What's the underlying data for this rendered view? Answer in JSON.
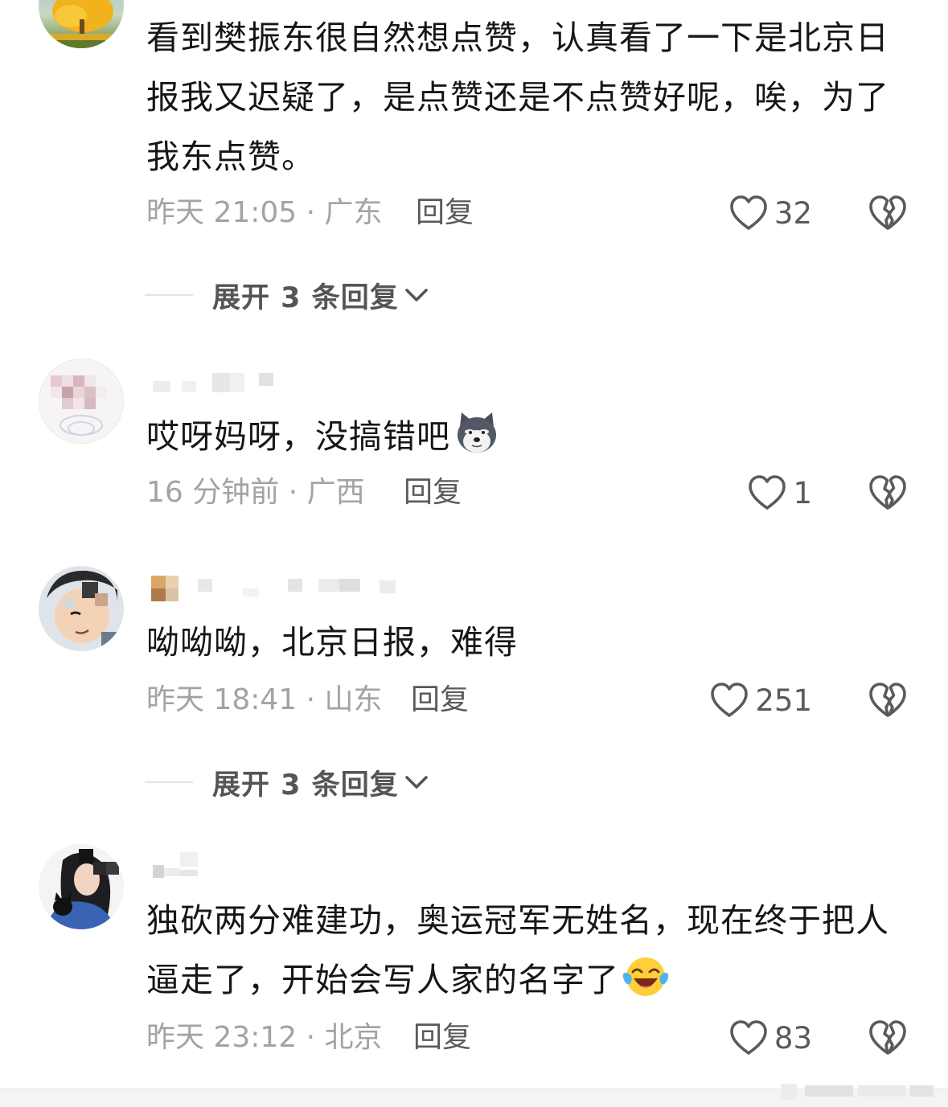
{
  "colors": {
    "text": "#161616",
    "meta": "#a3a3a3",
    "action": "#5a5a5a",
    "divider": "#e3e3e3"
  },
  "comments": [
    {
      "text": "看到樊振东很自然想点赞，认真看了一下是北京日报我又迟疑了，是点赞还是不点赞好呢，唉，为了我东点赞。",
      "meta": "昨天 21:05 · 广东",
      "reply": "回复",
      "likes": "32",
      "avatar": "golden-tree-avatar"
    },
    {
      "text": "哎呀妈呀，没搞错吧",
      "emoji": "husky-emoji",
      "meta": "16 分钟前 · 广西",
      "reply": "回复",
      "likes": "1",
      "avatar": "flower-avatar"
    },
    {
      "text": "呦呦呦，北京日报，难得",
      "meta": "昨天 18:41 · 山东",
      "reply": "回复",
      "likes": "251",
      "avatar": "cartoon-boy-avatar"
    },
    {
      "text": "独砍两分难建功，奥运冠军无姓名，现在终于把人逼走了，开始会写人家的名字了",
      "emoji": "laughing-tears-emoji",
      "meta": "昨天 23:12 · 北京",
      "reply": "回复",
      "likes": "83",
      "avatar": "girl-with-cat-avatar"
    }
  ],
  "expand_replies": [
    {
      "label": "展开 3 条回复"
    },
    {
      "label": "展开 3 条回复"
    }
  ],
  "icons": {
    "like": "heart-icon",
    "dislike": "broken-heart-icon",
    "expand": "chevron-down-icon"
  }
}
